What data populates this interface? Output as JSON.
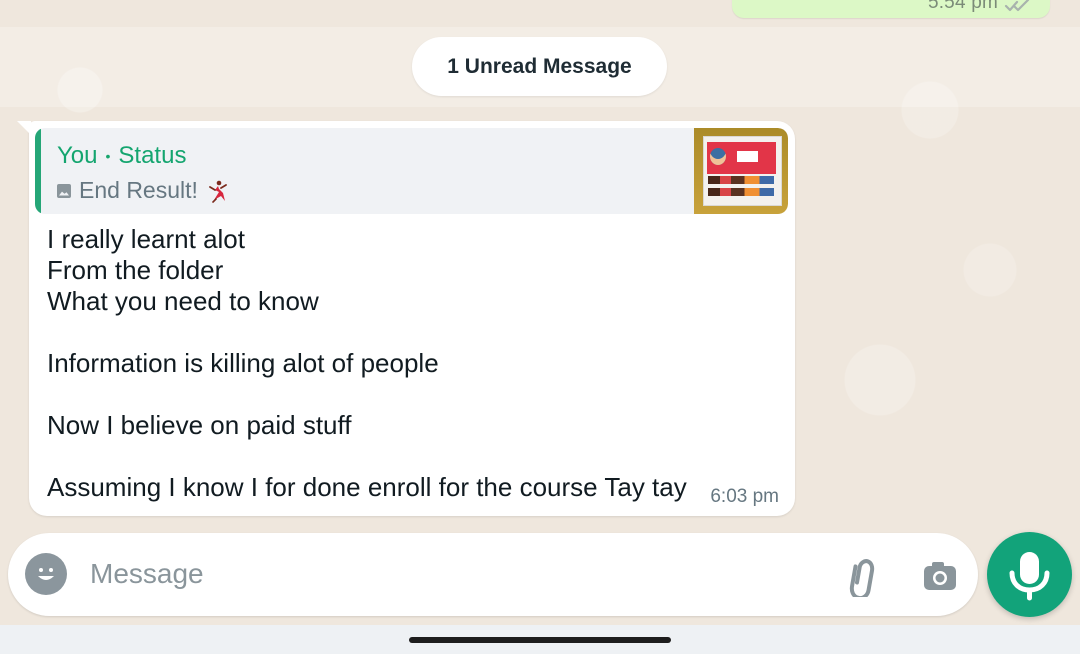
{
  "chat": {
    "top_message": {
      "time": "5:54 pm"
    },
    "unread_label": "1 Unread Message",
    "message": {
      "reply": {
        "author": "You",
        "separator": "•",
        "type": "Status",
        "media_icon": "image-icon",
        "caption": "End Result!",
        "emoji_icon": "dancer-icon"
      },
      "text": "I really learnt alot\nFrom the folder\nWhat you need to know\n\nInformation is killing alot of people\n\nNow I believe on paid stuff\n\nAssuming I know I for done enroll for the course Tay tay",
      "time": "6:03 pm"
    }
  },
  "composer": {
    "placeholder": "Message",
    "emoji_icon": "emoji-icon",
    "attach_icon": "paperclip-icon",
    "camera_icon": "camera-icon",
    "mic_icon": "mic-icon"
  },
  "colors": {
    "wallpaper": "#efe7dd",
    "outgoing_bubble": "#dcf8c6",
    "incoming_bubble": "#ffffff",
    "accent_green": "#12a37a",
    "quote_green": "#14a56f",
    "muted_text": "#667781"
  }
}
